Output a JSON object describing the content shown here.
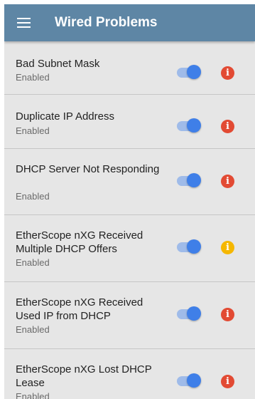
{
  "header": {
    "title": "Wired Problems",
    "menu_icon": "hamburger-menu-icon"
  },
  "problems": [
    {
      "name": "Bad Subnet Mask",
      "status": "Enabled",
      "enabled": true,
      "severity": "error"
    },
    {
      "name": "Duplicate IP Address",
      "status": "Enabled",
      "enabled": true,
      "severity": "error"
    },
    {
      "name": "DHCP Server Not Responding",
      "status": "Enabled",
      "enabled": true,
      "severity": "error"
    },
    {
      "name": "EtherScope nXG Received Multiple DHCP Offers",
      "status": "Enabled",
      "enabled": true,
      "severity": "warning"
    },
    {
      "name": "EtherScope nXG Received Used IP from DHCP",
      "status": "Enabled",
      "enabled": true,
      "severity": "error"
    },
    {
      "name": "EtherScope nXG Lost DHCP Lease",
      "status": "Enabled",
      "enabled": true,
      "severity": "error"
    }
  ],
  "colors": {
    "appbar": "#5e86a5",
    "error": "#e24a33",
    "warning": "#f5b700",
    "toggle_on": "#3f7fe8"
  },
  "info_glyph": "i"
}
